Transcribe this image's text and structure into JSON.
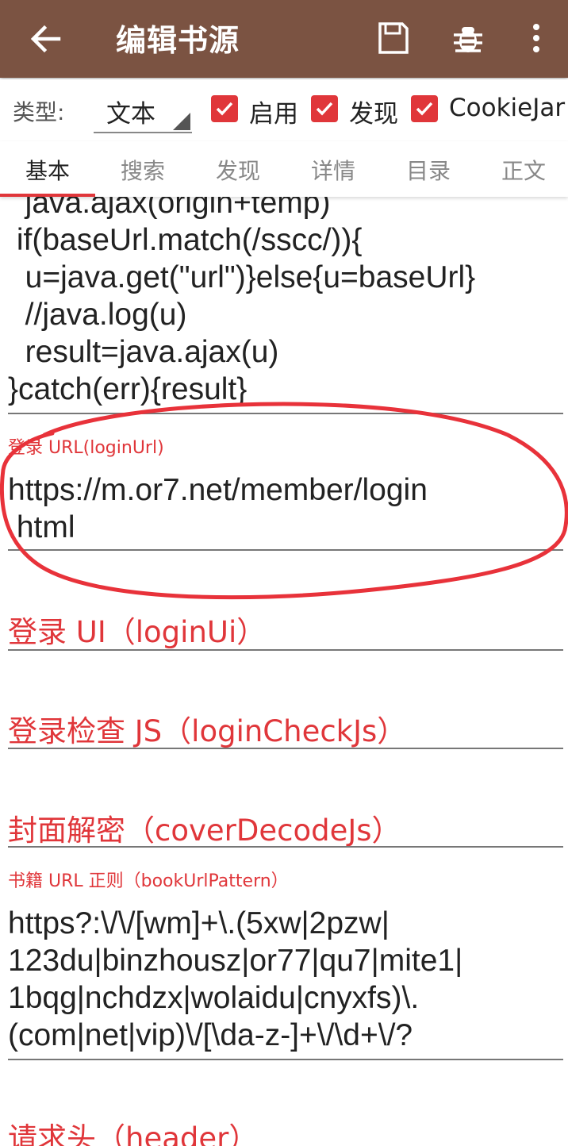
{
  "appbar": {
    "title": "编辑书源",
    "icons": [
      "back-arrow-icon",
      "save-icon",
      "bug-icon",
      "more-vert-icon"
    ],
    "color": "#7b5342"
  },
  "type_row": {
    "label": "类型:",
    "value": "文本",
    "enabled_label": "启用",
    "explore_label": "发现",
    "cookie_label": "CookieJar",
    "enabled": true,
    "explore": true,
    "cookie": true,
    "accent": "#e0363a"
  },
  "tabs": [
    "基本",
    "搜索",
    "发现",
    "详情",
    "目录",
    "正文"
  ],
  "active_tab": 0,
  "fields": {
    "login_url_script_lines": [
      "  java.ajax(origin+temp)",
      " if(baseUrl.match(/sscc/)){",
      "  u=java.get(\"url\")}else{u=baseUrl}",
      "  //java.log(u)",
      "  result=java.ajax(u)",
      "}catch(err){result}"
    ],
    "login_url_label": "登录 URL(loginUrl)",
    "login_url_value_line1": "https://m.or7.net/member/login",
    "login_url_value_line2": ".html",
    "login_ui_label": "登录 UI（loginUi）",
    "login_check_label": "登录检查 JS（loginCheckJs）",
    "cover_decode_label": "封面解密（coverDecodeJs）",
    "book_url_pattern_label": "书籍 URL 正则（bookUrlPattern）",
    "book_url_pattern_lines": [
      "https?:\\/\\/[wm]+\\.(5xw|2pzw|",
      "123du|binzhousz|or77|qu7|mite1|",
      "1bqg|nchdzx|wolaidu|cnyxfs)\\.",
      "(com|net|vip)\\/[\\da-z-]+\\/\\d+\\/?"
    ],
    "header_label": "请求头（header）"
  },
  "annotation_color": "#e8323a"
}
